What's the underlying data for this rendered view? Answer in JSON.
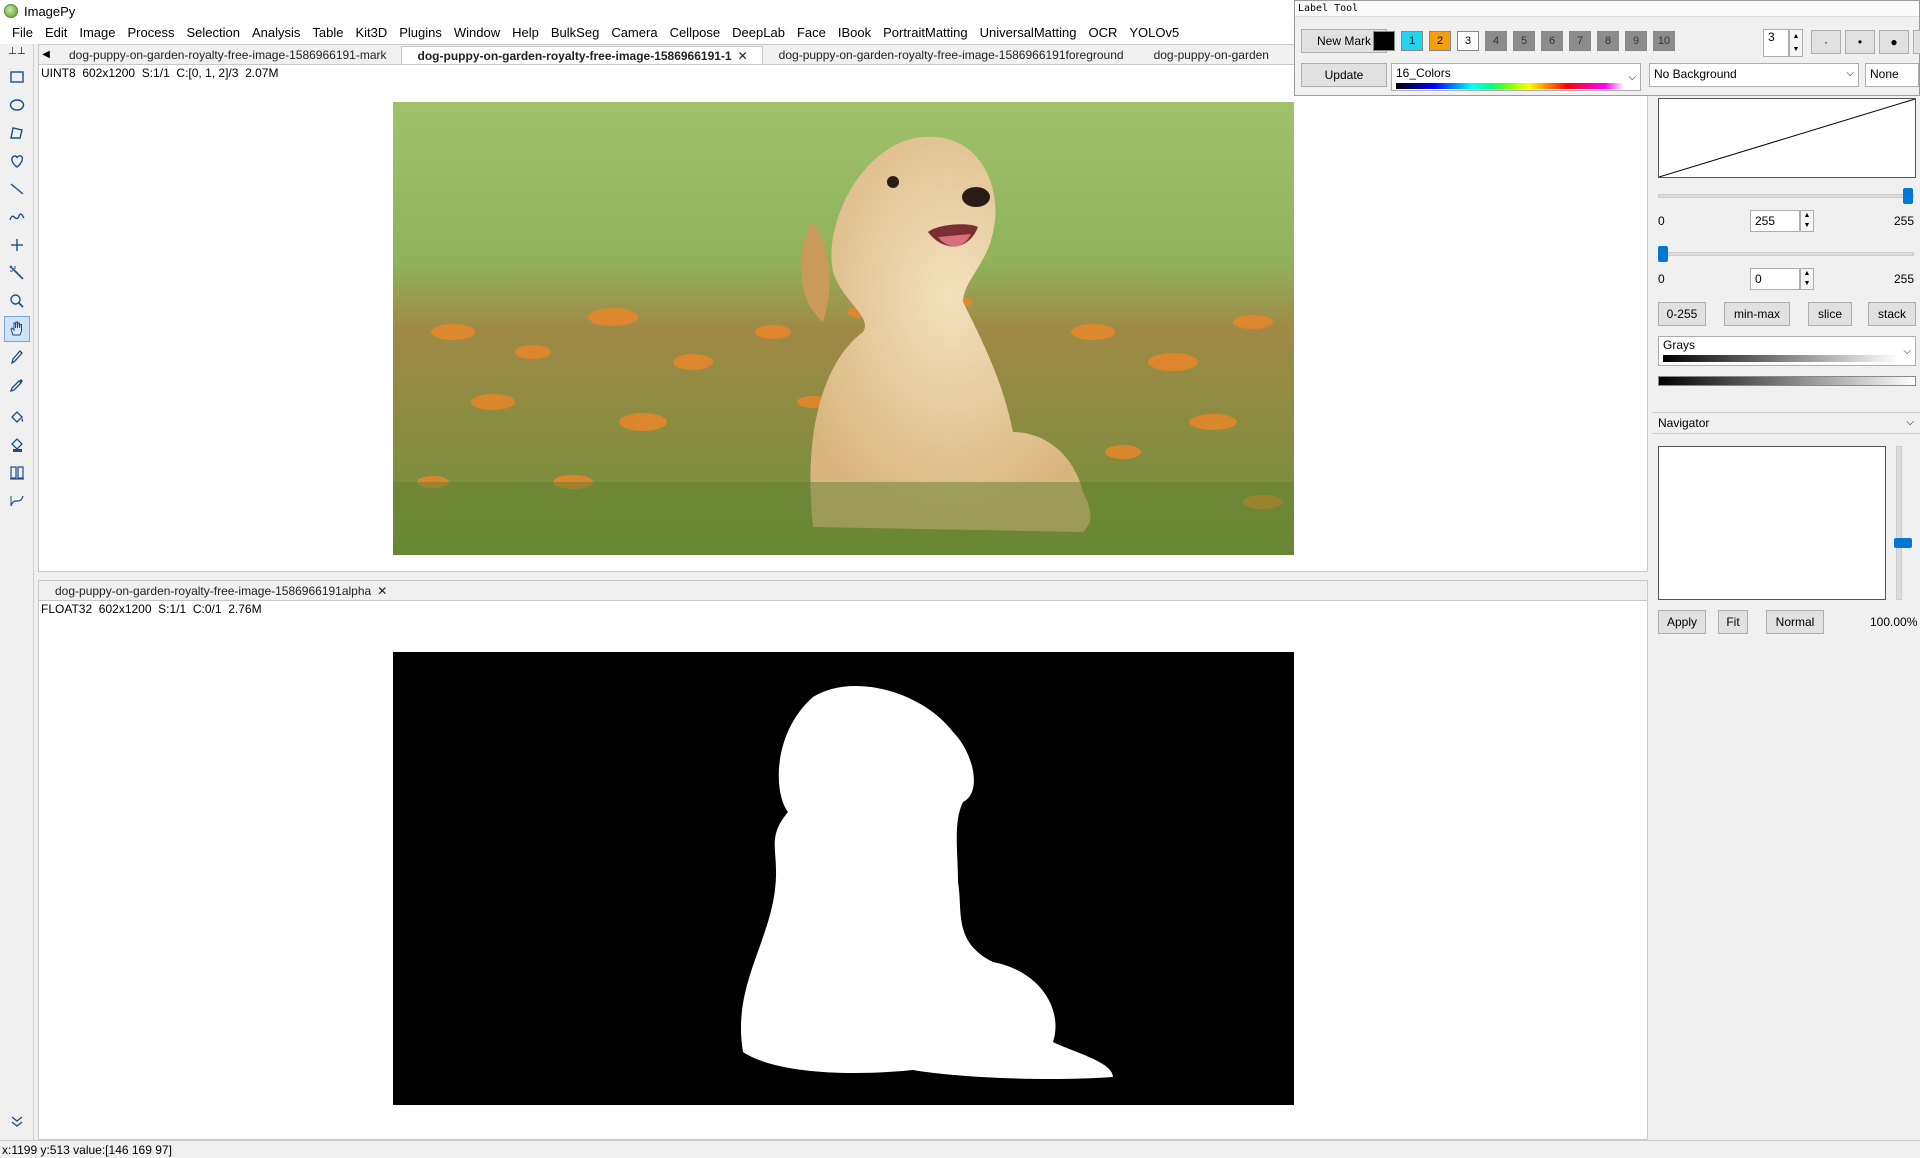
{
  "app": {
    "title": "ImagePy"
  },
  "menu": [
    "File",
    "Edit",
    "Image",
    "Process",
    "Selection",
    "Analysis",
    "Table",
    "Kit3D",
    "Plugins",
    "Window",
    "Help",
    "BulkSeg",
    "Camera",
    "Cellpose",
    "DeepLab",
    "Face",
    "IBook",
    "PortraitMatting",
    "UniversalMatting",
    "OCR",
    "YOLOv5"
  ],
  "tools": [
    "rectangle-select-icon",
    "ellipse-select-icon",
    "polygon-select-icon",
    "freehand-select-icon",
    "line-icon",
    "polyline-icon",
    "point-icon",
    "magic-wand-icon",
    "zoom-icon",
    "hand-icon",
    "pencil-icon",
    "eyedropper-icon",
    "bucket-fill-icon",
    "fill-stamp-icon",
    "text-icon",
    "measure-icon"
  ],
  "top_pane": {
    "tabs": [
      {
        "label": "dog-puppy-on-garden-royalty-free-image-1586966191-mark",
        "active": false
      },
      {
        "label": "dog-puppy-on-garden-royalty-free-image-1586966191-1",
        "active": true
      },
      {
        "label": "dog-puppy-on-garden-royalty-free-image-1586966191foreground",
        "active": false
      },
      {
        "label": "dog-puppy-on-garden",
        "active": false
      }
    ],
    "info": "UINT8  602x1200  S:1/1  C:[0, 1, 2]/3  2.07M"
  },
  "bottom_pane": {
    "tabs": [
      {
        "label": "dog-puppy-on-garden-royalty-free-image-1586966191alpha",
        "active": false
      }
    ],
    "info": "FLOAT32  602x1200  S:1/1  C:0/1  2.76M"
  },
  "label_tool": {
    "title": "Label Tool",
    "new_mark": "New Mark",
    "update": "Update",
    "swatches": [
      {
        "label": "",
        "color": "#000000"
      },
      {
        "label": "1",
        "color": "#22d3ee"
      },
      {
        "label": "2",
        "color": "#f59e0b"
      },
      {
        "label": "3",
        "color": "#ffffff"
      },
      {
        "label": "4",
        "color": "#8c8c8c"
      },
      {
        "label": "5",
        "color": "#8c8c8c"
      },
      {
        "label": "6",
        "color": "#8c8c8c"
      },
      {
        "label": "7",
        "color": "#8c8c8c"
      },
      {
        "label": "8",
        "color": "#8c8c8c"
      },
      {
        "label": "9",
        "color": "#8c8c8c"
      },
      {
        "label": "10",
        "color": "#8c8c8c"
      }
    ],
    "pen_size": "3",
    "dot_small": "·",
    "dot_mid": "•",
    "dot_big": "●",
    "colormap": "16_Colors",
    "background": "No Background",
    "blend": "None"
  },
  "contrast": {
    "max_value": "255",
    "min_value": "0",
    "range_min": "0",
    "range_max": "255",
    "btn_0_255": "0-255",
    "btn_minmax": "min-max",
    "btn_slice": "slice",
    "btn_stack": "stack",
    "lut": "Grays"
  },
  "navigator": {
    "header": "Navigator",
    "apply": "Apply",
    "fit": "Fit",
    "normal": "Normal",
    "zoom": "100.00%"
  },
  "status": "x:1199 y:513  value:[146 169  97]"
}
